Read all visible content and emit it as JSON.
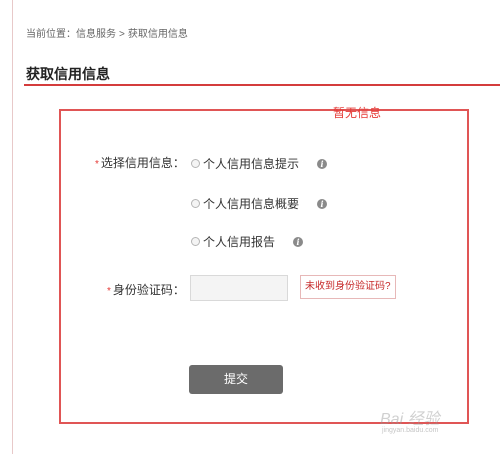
{
  "breadcrumb": {
    "prefix": "当前位置：",
    "item1": "信息服务",
    "separator": ">",
    "item2": "获取信用信息"
  },
  "page_title": "获取信用信息",
  "panel": {
    "notice": "暂无信息",
    "credit_select_label": "选择信用信息：",
    "options": [
      {
        "label": "个人信用信息提示",
        "selected": false
      },
      {
        "label": "个人信用信息概要",
        "selected": false
      },
      {
        "label": "个人信用报告",
        "selected": false
      }
    ],
    "id_code_label": "身份验证码：",
    "id_code_value": "",
    "no_code_link": "未收到身份验证码?",
    "submit_label": "提交",
    "required_mark": "*"
  },
  "icons": {
    "option_info": "info-icon",
    "info_glyph": "i"
  },
  "watermark": {
    "main": "Bai 经验",
    "sub": "jingyan.baidu.com"
  },
  "colors": {
    "accent_red": "#e53935",
    "panel_border": "#e05555",
    "button_gray": "#6b6b6b"
  }
}
